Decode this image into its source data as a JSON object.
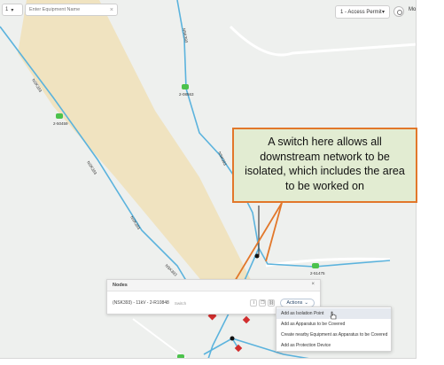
{
  "toolbar": {
    "zone_value": "1",
    "search_placeholder": "Enter Equipment Name",
    "permit_value": "1 - Access Permit",
    "more_label": "Mo"
  },
  "map": {
    "line_labels": [
      "NSK393",
      "NSK393",
      "NSK393",
      "NSK393",
      "NSK393",
      "NSK393"
    ],
    "nodes": [
      {
        "label": "2-08563"
      },
      {
        "label": "2-50459"
      },
      {
        "label": "2-51475"
      }
    ],
    "zone_fill_color": "#f0e3c0",
    "line_color": "#5bb3dd",
    "node_color": "#4cc24c",
    "switch_color": "#d12e2e"
  },
  "callout": {
    "text": "A switch here allows all downstream network to be isolated, which includes the area to be worked on",
    "border_color": "#e2772a",
    "fill_color": "#e2ecd2"
  },
  "nodes_panel": {
    "title": "Nodes",
    "close_label": "×",
    "row": {
      "name": "(NSK393) - 11kV - 2-R10848",
      "type": "Switch",
      "actions_label": "Actions"
    }
  },
  "menu": {
    "items": [
      {
        "label": "Add as Isolation Point",
        "highlighted": true
      },
      {
        "label": "Add as Apparatus to be Covered",
        "highlighted": false
      },
      {
        "label": "Create nearby Equipment as Apparatus to be Covered",
        "highlighted": false
      },
      {
        "label": "Add as Protection Device",
        "highlighted": false
      }
    ]
  }
}
